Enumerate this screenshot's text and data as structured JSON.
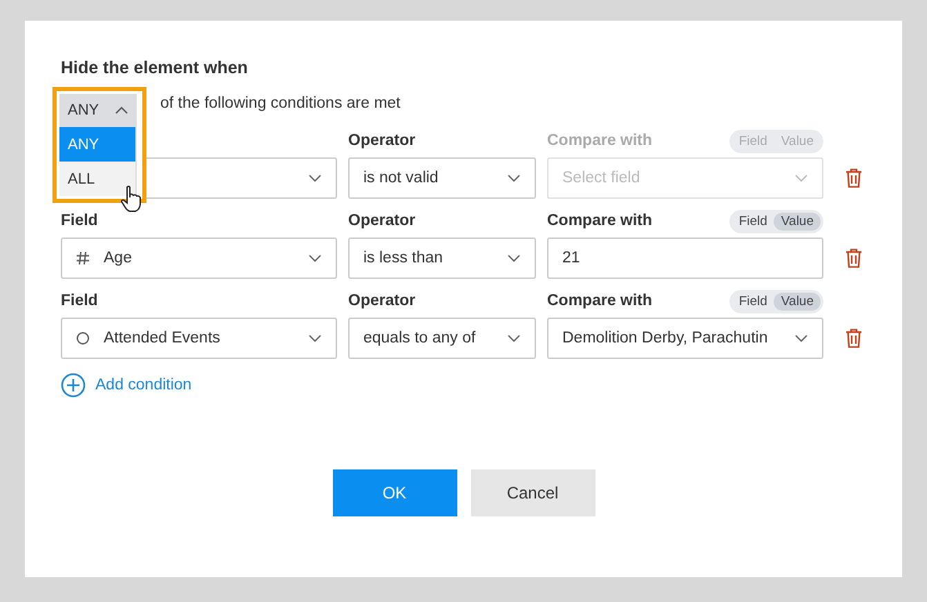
{
  "dialog": {
    "title": "Hide the element when",
    "match": {
      "value": "ANY",
      "expanded": true,
      "options": [
        {
          "label": "ANY",
          "selected": true
        },
        {
          "label": "ALL",
          "selected": false
        }
      ]
    },
    "match_text": "of the following conditions are met"
  },
  "conditions": [
    {
      "operator_label": "Operator",
      "operator": "is not valid",
      "compare_label": "Compare with",
      "compare_disabled": true,
      "toggle": [
        {
          "label": "Field",
          "selected": false
        },
        {
          "label": "Value",
          "selected": false
        }
      ],
      "compare": {
        "kind": "select",
        "placeholder": "Select field"
      }
    },
    {
      "field_label": "Field",
      "field": {
        "kind": "number",
        "value": "Age"
      },
      "operator_label": "Operator",
      "operator": "is less than",
      "compare_label": "Compare with",
      "compare_disabled": false,
      "toggle": [
        {
          "label": "Field",
          "selected": false
        },
        {
          "label": "Value",
          "selected": true
        }
      ],
      "compare": {
        "kind": "input",
        "value": "21"
      }
    },
    {
      "field_label": "Field",
      "field": {
        "kind": "choice",
        "value": "Attended Events"
      },
      "operator_label": "Operator",
      "operator": "equals to any of",
      "compare_label": "Compare with",
      "compare_disabled": false,
      "toggle": [
        {
          "label": "Field",
          "selected": false
        },
        {
          "label": "Value",
          "selected": true
        }
      ],
      "compare": {
        "kind": "select",
        "value": "Demolition Derby, Parachutin"
      }
    }
  ],
  "add_condition": "Add condition",
  "buttons": [
    {
      "label": "OK",
      "kind": "primary"
    },
    {
      "label": "Cancel",
      "kind": "secondary"
    }
  ]
}
